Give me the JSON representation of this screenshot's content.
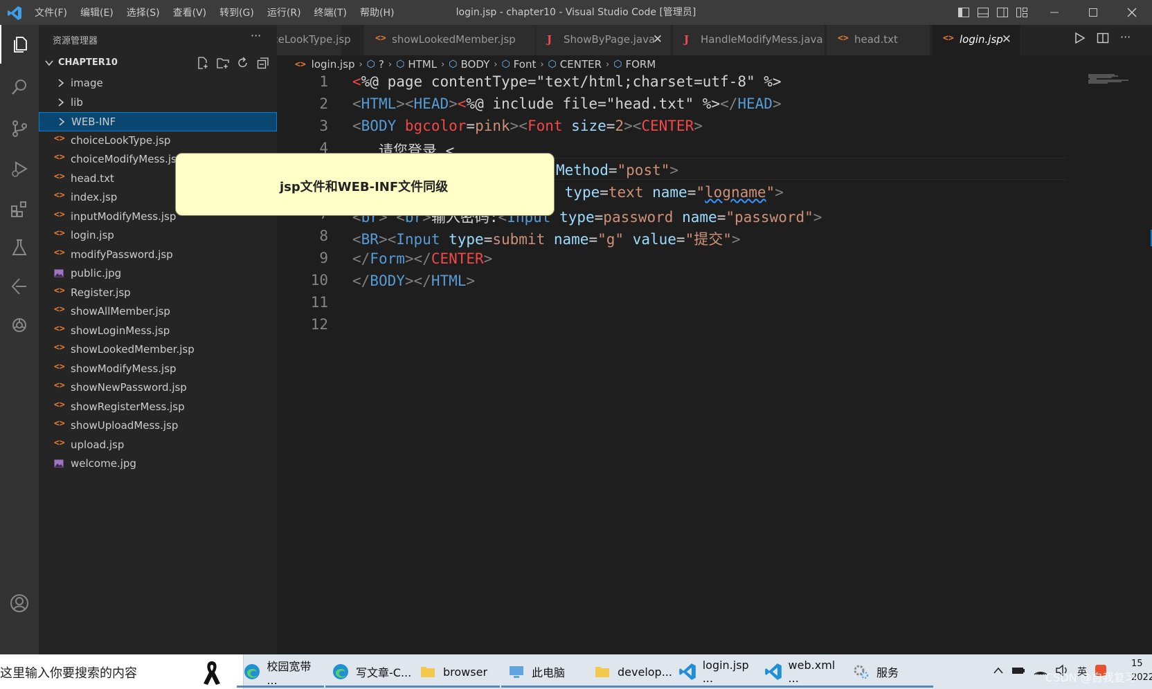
{
  "titlebar": {
    "menu": [
      "文件(F)",
      "编辑(E)",
      "选择(S)",
      "查看(V)",
      "转到(G)",
      "运行(R)",
      "终端(T)",
      "帮助(H)"
    ],
    "window_title": "login.jsp - chapter10 - Visual Studio Code [管理员]"
  },
  "sidebar": {
    "header": "资源管理器",
    "folder": "CHAPTER10",
    "files": [
      {
        "name": "image",
        "kind": "folder"
      },
      {
        "name": "lib",
        "kind": "folder"
      },
      {
        "name": "WEB-INF",
        "kind": "folder",
        "selected": true
      },
      {
        "name": "choiceLookType.jsp",
        "kind": "code"
      },
      {
        "name": "choiceModifyMess.jsp",
        "kind": "code"
      },
      {
        "name": "head.txt",
        "kind": "code"
      },
      {
        "name": "index.jsp",
        "kind": "code"
      },
      {
        "name": "inputModifyMess.jsp",
        "kind": "code"
      },
      {
        "name": "login.jsp",
        "kind": "code"
      },
      {
        "name": "modifyPassword.jsp",
        "kind": "code"
      },
      {
        "name": "public.jpg",
        "kind": "image"
      },
      {
        "name": "Register.jsp",
        "kind": "code"
      },
      {
        "name": "showAllMember.jsp",
        "kind": "code"
      },
      {
        "name": "showLoginMess.jsp",
        "kind": "code"
      },
      {
        "name": "showLookedMember.jsp",
        "kind": "code"
      },
      {
        "name": "showModifyMess.jsp",
        "kind": "code"
      },
      {
        "name": "showNewPassword.jsp",
        "kind": "code"
      },
      {
        "name": "showRegisterMess.jsp",
        "kind": "code"
      },
      {
        "name": "showUploadMess.jsp",
        "kind": "code"
      },
      {
        "name": "upload.jsp",
        "kind": "code"
      },
      {
        "name": "welcome.jpg",
        "kind": "image"
      }
    ]
  },
  "tabs": [
    {
      "label": "oiceLookType.jsp",
      "icon": "code"
    },
    {
      "label": "showLookedMember.jsp",
      "icon": "code"
    },
    {
      "label": "ShowByPage.java",
      "icon": "java",
      "close": "✕"
    },
    {
      "label": "HandleModifyMess.java",
      "icon": "java"
    },
    {
      "label": "head.txt",
      "icon": "code"
    },
    {
      "label": "login.jsp",
      "icon": "code",
      "active": true,
      "close": "✕"
    }
  ],
  "breadcrumb": [
    "login.jsp",
    "?",
    "HTML",
    "BODY",
    "Font",
    "CENTER",
    "FORM"
  ],
  "editor": {
    "line_numbers": [
      "1",
      "2",
      "3",
      "4",
      "5",
      "6",
      "7",
      "8",
      "9",
      "10",
      "11",
      "12"
    ],
    "line3_partial": "   请您登录 <",
    "line5_tail": "Method=\"post\">",
    "line6_tail": " type=text name=\"logname\">",
    "line7_text": "输入密码:",
    "line8_value": "提交"
  },
  "annotation": "jsp文件和WEB-INF文件同级",
  "taskbar": {
    "search_text": "这里输入你要搜索的内容",
    "items": [
      {
        "label": "校园宽带 ...",
        "icon": "edge"
      },
      {
        "label": "写文章-C...",
        "icon": "edge"
      },
      {
        "label": "browser",
        "icon": "folder"
      },
      {
        "label": "此电脑",
        "icon": "pc"
      },
      {
        "label": "develop...",
        "icon": "folder"
      },
      {
        "label": "login.jsp ...",
        "icon": "vscode"
      },
      {
        "label": "web.xml ...",
        "icon": "vscode"
      },
      {
        "label": "服务",
        "icon": "services"
      }
    ],
    "ime": "英",
    "clock_top": "15",
    "clock_bottom": "2022"
  },
  "watermark": "CSDN @自我复习"
}
